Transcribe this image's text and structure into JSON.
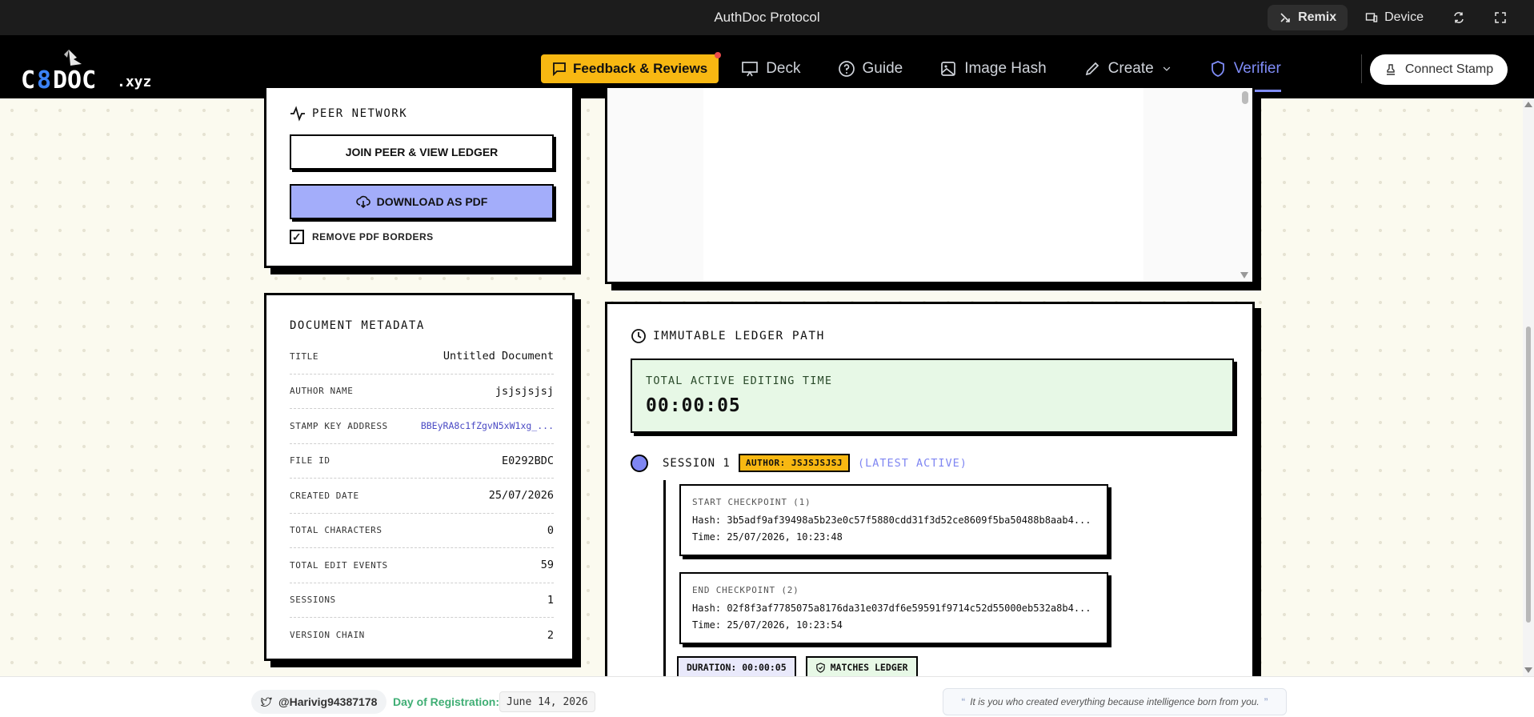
{
  "appbar": {
    "title": "AuthDoc Protocol",
    "remix": "Remix",
    "device": "Device"
  },
  "nav": {
    "logo_alt": "C8DOC .xyz",
    "feedback": "Feedback & Reviews",
    "deck": "Deck",
    "guide": "Guide",
    "image_hash": "Image Hash",
    "create": "Create",
    "verifier": "Verifier",
    "connect": "Connect Stamp"
  },
  "peer": {
    "title": "PEER NETWORK",
    "join": "JOIN PEER & VIEW LEDGER",
    "download": "DOWNLOAD AS PDF",
    "remove_borders": "REMOVE PDF BORDERS",
    "remove_borders_checked": true
  },
  "meta": {
    "title": "DOCUMENT METADATA",
    "rows": [
      {
        "k": "TITLE",
        "v": "Untitled Document"
      },
      {
        "k": "AUTHOR NAME",
        "v": "jsjsjsjsj"
      },
      {
        "k": "STAMP KEY ADDRESS",
        "v": "BBEyRA8c1fZgvN5xW1xg_..."
      },
      {
        "k": "FILE ID",
        "v": "E0292BDC"
      },
      {
        "k": "CREATED DATE",
        "v": "25/07/2026"
      },
      {
        "k": "TOTAL CHARACTERS",
        "v": "0"
      },
      {
        "k": "TOTAL EDIT EVENTS",
        "v": "59"
      },
      {
        "k": "SESSIONS",
        "v": "1"
      },
      {
        "k": "VERSION CHAIN",
        "v": "2"
      }
    ]
  },
  "ledger": {
    "title": "IMMUTABLE LEDGER PATH",
    "time_label": "TOTAL ACTIVE EDITING TIME",
    "time_value": "00:00:05",
    "session_label": "SESSION 1",
    "session_author": "AUTHOR: JSJSJSJSJ",
    "session_latest": "(LATEST ACTIVE)",
    "checkpoints": [
      {
        "head": "START CHECKPOINT (1)",
        "hash": "Hash: 3b5adf9af39498a5b23e0c57f5880cdd31f3d52ce8609f5ba50488b8aab4...",
        "time": "Time: 25/07/2026, 10:23:48"
      },
      {
        "head": "END CHECKPOINT (2)",
        "hash": "Hash: 02f8f3af7785075a8176da31e037df6e59591f9714c52d55000eb532a8b4...",
        "time": "Time: 25/07/2026, 10:23:54"
      }
    ],
    "duration": "DURATION: 00:00:05",
    "matches": "MATCHES LEDGER"
  },
  "footer": {
    "handle": "@Harivig94387178",
    "dor_label": "Day of Registration:",
    "dor_value": "June 14, 2026",
    "quote": "It is you who created everything because intelligence born from you."
  },
  "colors": {
    "accent": "#7f8cf7",
    "feedback": "#f8b812",
    "pdf_button": "#a3adfa",
    "time_bg": "#e7f8e6"
  }
}
